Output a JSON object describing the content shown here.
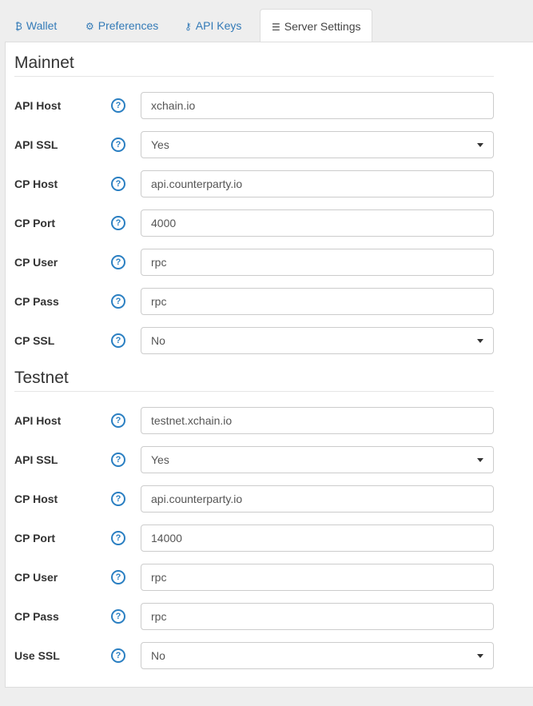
{
  "tabs": [
    {
      "label": "Wallet",
      "icon": "bitcoin-icon"
    },
    {
      "label": "Preferences",
      "icon": "gear-icon"
    },
    {
      "label": "API Keys",
      "icon": "key-icon"
    },
    {
      "label": "Server Settings",
      "icon": "server-icon"
    }
  ],
  "active_tab": "Server Settings",
  "mainnet": {
    "title": "Mainnet",
    "fields": [
      {
        "label": "API Host",
        "value": "xchain.io"
      },
      {
        "label": "API SSL",
        "value": "Yes"
      },
      {
        "label": "CP Host",
        "value": "api.counterparty.io"
      },
      {
        "label": "CP Port",
        "value": "4000"
      },
      {
        "label": "CP User",
        "value": "rpc"
      },
      {
        "label": "CP Pass",
        "value": "rpc"
      },
      {
        "label": "CP SSL",
        "value": "No"
      }
    ]
  },
  "testnet": {
    "title": "Testnet",
    "fields": [
      {
        "label": "API Host",
        "value": "testnet.xchain.io"
      },
      {
        "label": "API SSL",
        "value": "Yes"
      },
      {
        "label": "CP Host",
        "value": "api.counterparty.io"
      },
      {
        "label": "CP Port",
        "value": "14000"
      },
      {
        "label": "CP User",
        "value": "rpc"
      },
      {
        "label": "CP Pass",
        "value": "rpc"
      },
      {
        "label": "Use SSL",
        "value": "No"
      }
    ]
  },
  "help_glyph": "?",
  "colors": {
    "link": "#337ab7",
    "help": "#2a7fc2",
    "border": "#ddd"
  }
}
